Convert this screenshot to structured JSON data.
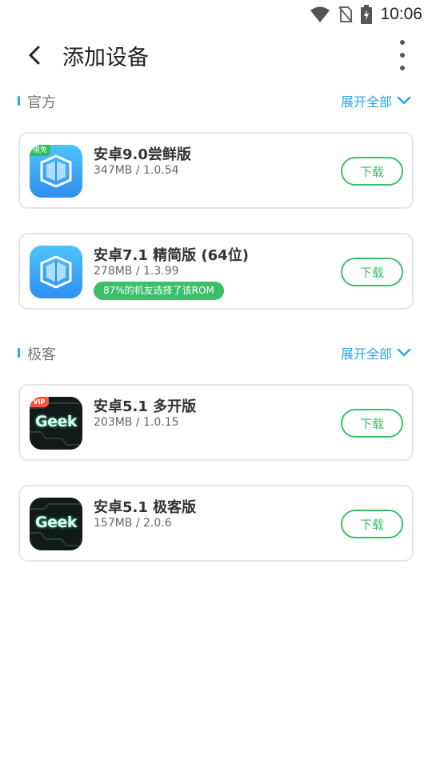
{
  "status_bar": {
    "time": "10:06",
    "icons": [
      "wifi-icon",
      "no-sim-icon",
      "battery-charging-icon"
    ]
  },
  "app_bar": {
    "title": "添加设备",
    "back_icon": "chevron-left-icon",
    "more_icon": "more-vertical-icon"
  },
  "sections": [
    {
      "title": "官方",
      "expand_label": "展开全部",
      "items": [
        {
          "name": "安卓9.0尝鲜版",
          "meta": "347MB / 1.0.54",
          "button": "下载",
          "badge": "限免",
          "icon": "virtual-machine-cube-icon"
        },
        {
          "name": "安卓7.1 精简版 (64位)",
          "meta": "278MB / 1.3.99",
          "button": "下载",
          "tag": "87%的机友选择了该ROM",
          "icon": "virtual-machine-cube-icon"
        }
      ]
    },
    {
      "title": "极客",
      "expand_label": "展开全部",
      "items": [
        {
          "name": "安卓5.1 多开版",
          "meta": "203MB / 1.0.15",
          "button": "下载",
          "badge": "VIP",
          "icon_text": "Geek",
          "icon": "geek-logo-icon"
        },
        {
          "name": "安卓5.1 极客版",
          "meta": "157MB / 2.0.6",
          "button": "下载",
          "icon_text": "Geek",
          "icon": "geek-logo-icon"
        }
      ]
    }
  ],
  "colors": {
    "accent_blue": "#29a5e8",
    "green": "#3cbf6b",
    "card_border": "#e6e6e6"
  }
}
